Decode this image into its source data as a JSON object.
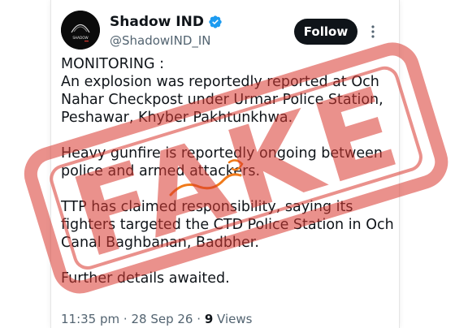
{
  "account": {
    "display_name": "Shadow IND",
    "handle": "@ShadowIND_IN",
    "avatar_text": "SHADOW"
  },
  "actions": {
    "follow_label": "Follow"
  },
  "tweet": {
    "line_1": "MONITORING :",
    "paragraph_1": "An explosion was reportedly reported at Och Nahar Checkpost under Urmar Police Station, Peshawar, Khyber Pakhtunkhwa.",
    "paragraph_2": "Heavy gunfire is reportedly ongoing between police and armed attackers.",
    "paragraph_3": "TTP has claimed responsibility, saying its fighters targeted the CTD Police Station in Och Canal Baghbanan, Badbher.",
    "paragraph_4": "Further details awaited."
  },
  "meta": {
    "time": "11:35 pm",
    "separator": "·",
    "date": "28 Sep 26",
    "views_count": "9",
    "views_label": "Views"
  },
  "stamp": {
    "text": "FAKE",
    "color": "#d9382f"
  },
  "colors": {
    "verified": "#1d9bf0",
    "text_primary": "#0f1419",
    "text_secondary": "#536471",
    "scribble": "#f07a1a"
  }
}
